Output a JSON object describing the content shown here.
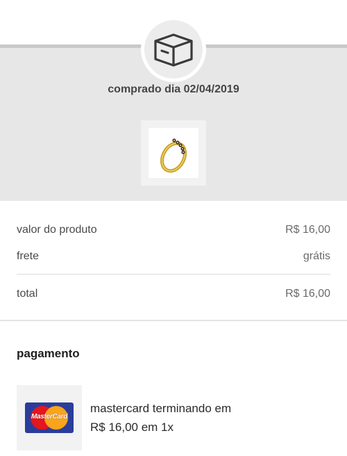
{
  "order": {
    "purchase_date_text": "comprado dia 02/04/2019",
    "box_icon": "package-box-icon",
    "product_image": "gold-ring-with-stones"
  },
  "summary": {
    "product_label": "valor do produto",
    "product_value": "R$ 16,00",
    "shipping_label": "frete",
    "shipping_value": "grátis",
    "total_label": "total",
    "total_value": "R$ 16,00"
  },
  "payment": {
    "title": "pagamento",
    "card_brand_logo_text": "MasterCard",
    "card_line1": "mastercard terminando em",
    "card_line2": "R$ 16,00 em 1x"
  },
  "colors": {
    "header_band": "#e7e7e7",
    "mastercard_red": "#e4161f",
    "mastercard_yellow": "#f8a51b",
    "mastercard_bg": "#2b3d9a"
  }
}
